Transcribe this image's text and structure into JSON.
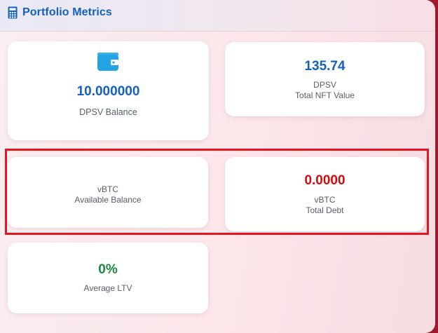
{
  "header": {
    "title": "Portfolio Metrics",
    "icon": "calculator-icon"
  },
  "colors": {
    "blue": "#1460c2",
    "red": "#d40b0b",
    "green": "#178a3f",
    "highlight": "#e8141d"
  },
  "cards": {
    "dpsv_balance": {
      "value": "10.000000",
      "label": "DPSV Balance",
      "icon": "wallet-icon"
    },
    "nft_value": {
      "value": "135.74",
      "unit": "DPSV",
      "label": "Total NFT Value"
    },
    "available": {
      "unit": "vBTC",
      "label": "Available Balance"
    },
    "debt": {
      "value": "0.0000",
      "unit": "vBTC",
      "label": "Total Debt"
    },
    "ltv": {
      "value": "0%",
      "label": "Average LTV"
    }
  }
}
